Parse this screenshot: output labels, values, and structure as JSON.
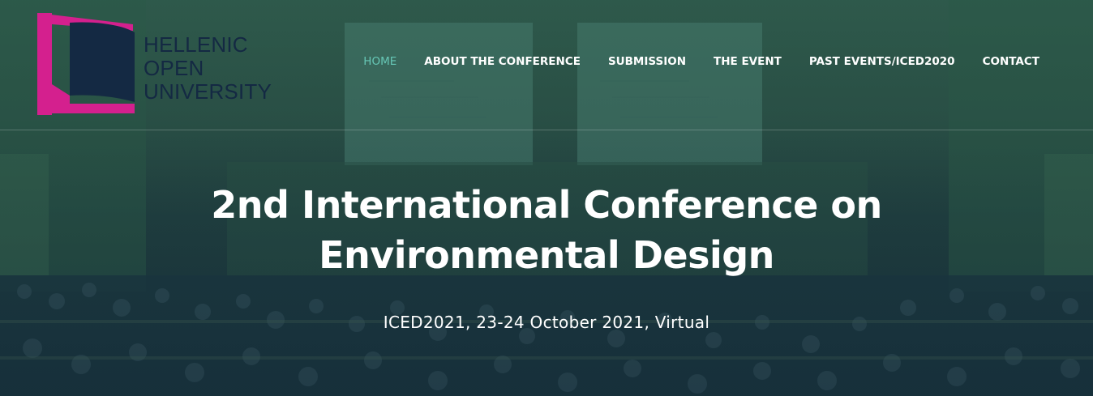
{
  "logo": {
    "line1": "HELLENIC",
    "line2": "OPEN",
    "line3": "UNIVERSITY",
    "colors": {
      "magenta": "#d4208e",
      "navy": "#142943"
    }
  },
  "nav": {
    "items": [
      {
        "label": "HOME",
        "active": true
      },
      {
        "label": "ABOUT THE CONFERENCE",
        "active": false
      },
      {
        "label": "SUBMISSION",
        "active": false
      },
      {
        "label": "THE EVENT",
        "active": false
      },
      {
        "label": "PAST EVENTS/ICED2020",
        "active": false
      },
      {
        "label": "CONTACT",
        "active": false
      }
    ],
    "active_color": "#66c7b6"
  },
  "hero": {
    "title_line1": "2nd International Conference on",
    "title_line2": "Environmental Design",
    "subtitle": "ICED2021, 23-24 October 2021, Virtual"
  }
}
